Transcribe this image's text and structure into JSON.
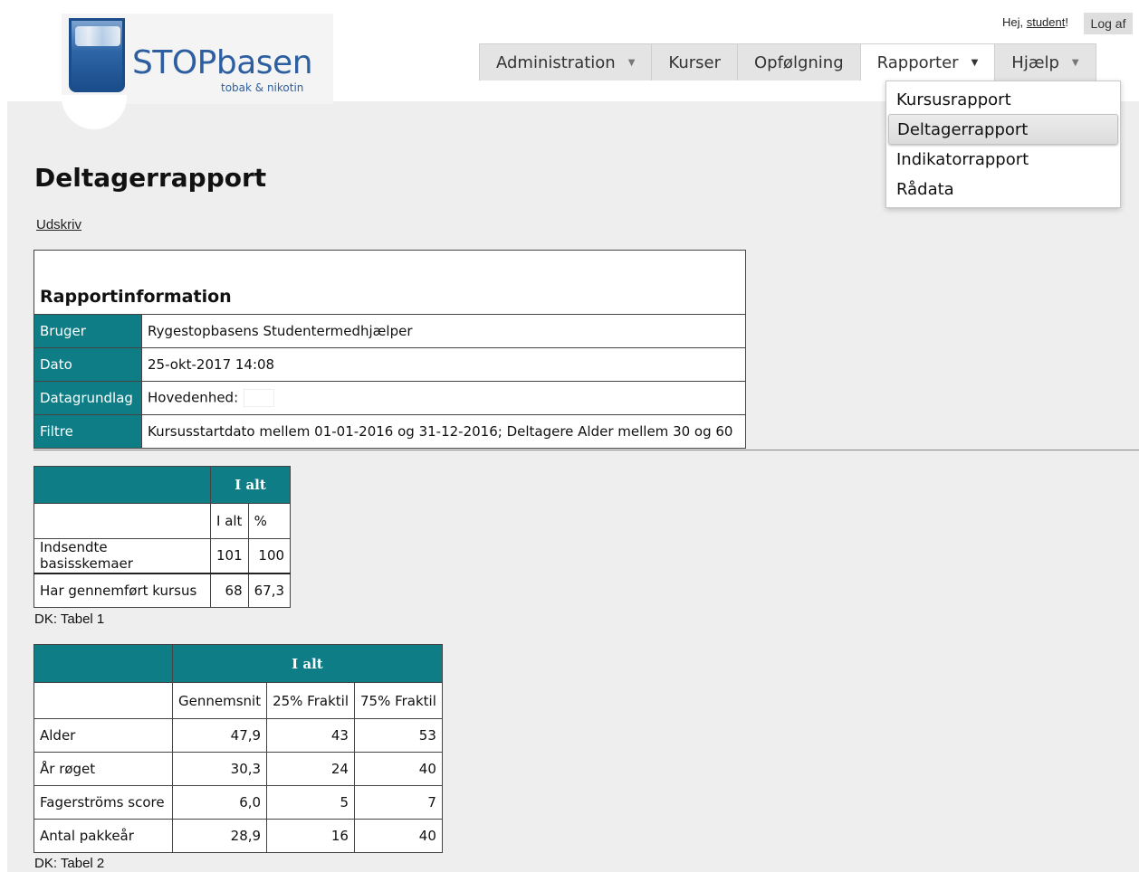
{
  "header": {
    "logo_text": "STOPbasen",
    "logo_sub": "tobak & nikotin",
    "greeting_prefix": "Hej, ",
    "username": "student",
    "greeting_suffix": "!",
    "logout": "Log af"
  },
  "nav": {
    "items": [
      {
        "label": "Administration",
        "has_caret": true
      },
      {
        "label": "Kurser",
        "has_caret": false
      },
      {
        "label": "Opfølgning",
        "has_caret": false
      },
      {
        "label": "Rapporter",
        "has_caret": true,
        "active": true
      },
      {
        "label": "Hjælp",
        "has_caret": true
      }
    ],
    "dropdown": [
      "Kursusrapport",
      "Deltagerrapport",
      "Indikatorrapport",
      "Rådata"
    ],
    "highlighted": "Deltagerrapport"
  },
  "page": {
    "title": "Deltagerrapport",
    "print_link": "Udskriv"
  },
  "report_info": {
    "title": "Rapportinformation",
    "rows": [
      {
        "label": "Bruger",
        "value": "Rygestopbasens Studentermedhjælper"
      },
      {
        "label": "Dato",
        "value": "25-okt-2017 14:08"
      },
      {
        "label": "Datagrundlag",
        "value": "Hovedenhed:"
      },
      {
        "label": "Filtre",
        "value": "Kursusstartdato mellem 01-01-2016 og 31-12-2016; Deltagere Alder mellem 30 og 60"
      }
    ]
  },
  "table1": {
    "group_header": "I alt",
    "col_headers": [
      "I alt",
      "%"
    ],
    "rows": [
      {
        "label": "Indsendte basisskemaer",
        "values": [
          "101",
          "100"
        ]
      },
      {
        "label": "Har gennemført kursus",
        "values": [
          "68",
          "67,3"
        ]
      }
    ],
    "caption": "DK: Tabel 1"
  },
  "table2": {
    "group_header": "I alt",
    "col_headers": [
      "Gennemsnit",
      "25% Fraktil",
      "75% Fraktil"
    ],
    "rows": [
      {
        "label": "Alder",
        "values": [
          "47,9",
          "43",
          "53"
        ]
      },
      {
        "label": "År røget",
        "values": [
          "30,3",
          "24",
          "40"
        ]
      },
      {
        "label": "Fagerströms score",
        "values": [
          "6,0",
          "5",
          "7"
        ]
      },
      {
        "label": "Antal pakkeår",
        "values": [
          "28,9",
          "16",
          "40"
        ]
      }
    ],
    "caption": "DK: Tabel 2"
  },
  "colors": {
    "accent": "#0e7d86",
    "background": "#eeeeee"
  }
}
